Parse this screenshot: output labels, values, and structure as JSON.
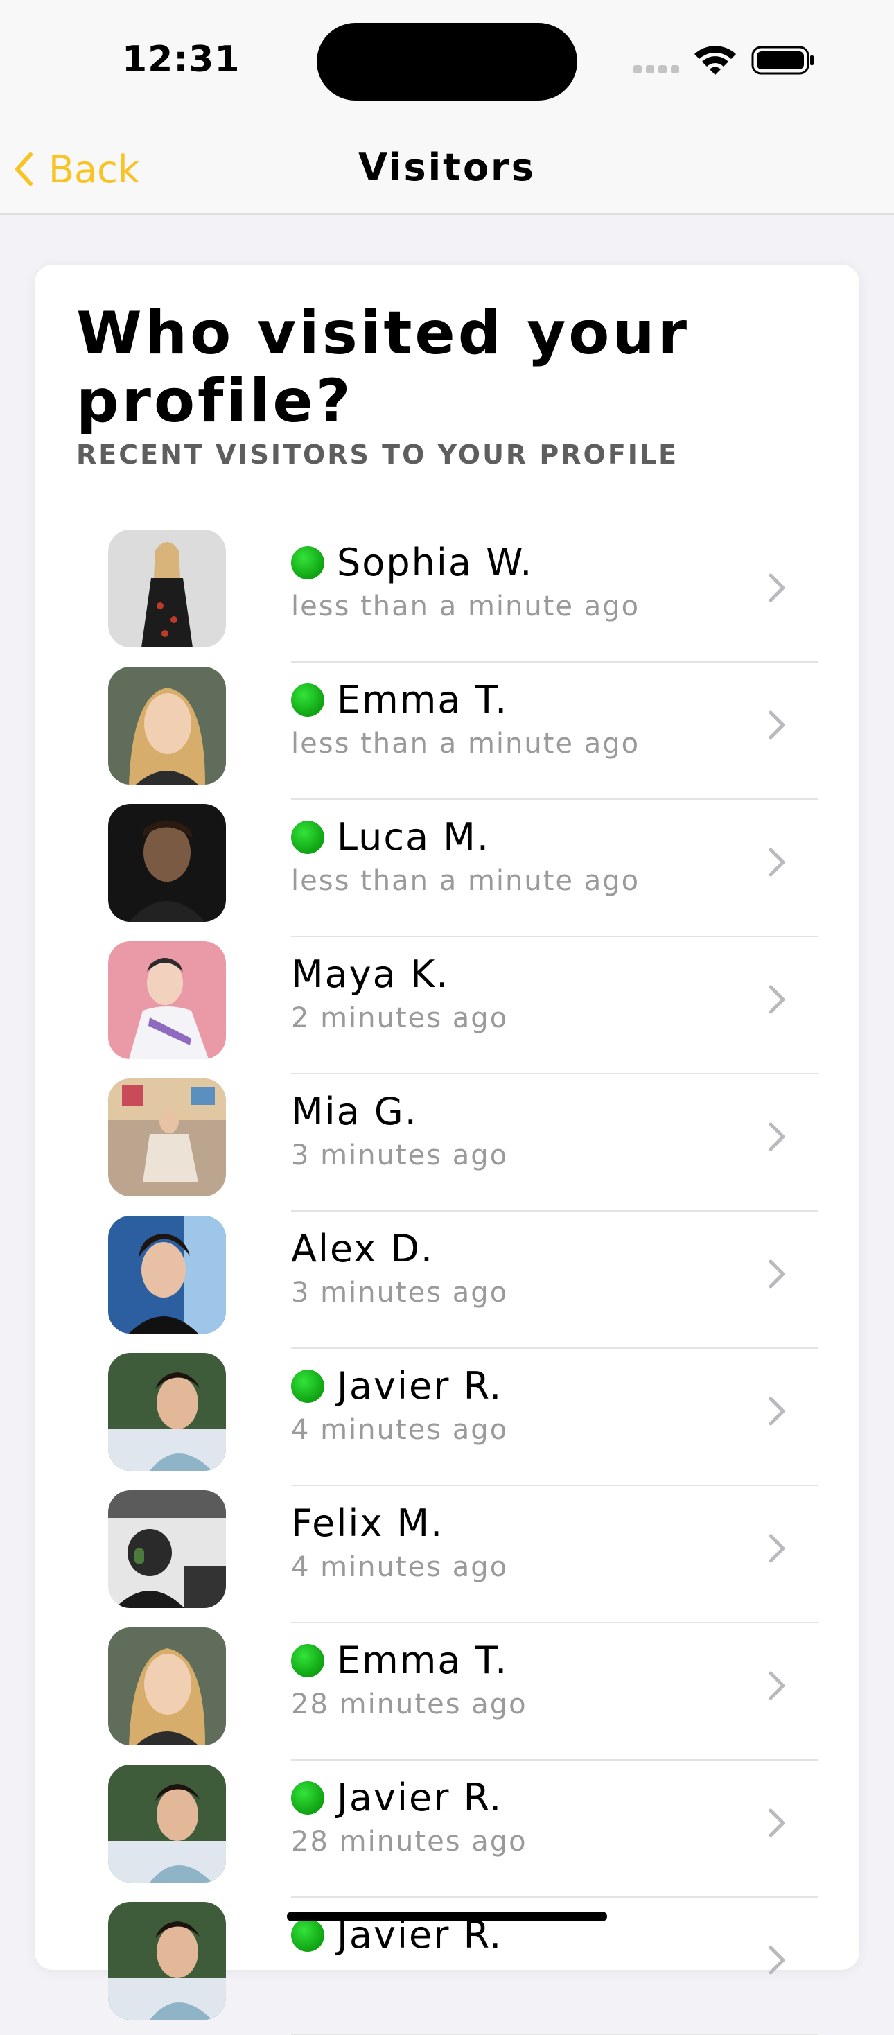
{
  "status_bar": {
    "time": "12:31"
  },
  "nav": {
    "back_label": "Back",
    "title": "Visitors"
  },
  "colors": {
    "accent": "#f7c325",
    "online": "#1ec322",
    "secondary_text": "#9a9a9a"
  },
  "card": {
    "heading": "Who visited your profile?",
    "subheading": "RECENT VISITORS TO YOUR PROFILE"
  },
  "visitors": [
    {
      "name": "Sophia W.",
      "time": "less than a minute ago",
      "online": true,
      "avatar": "photo-woman-dress"
    },
    {
      "name": "Emma T.",
      "time": "less than a minute ago",
      "online": true,
      "avatar": "photo-woman-blonde"
    },
    {
      "name": "Luca M.",
      "time": "less than a minute ago",
      "online": true,
      "avatar": "photo-man-dark"
    },
    {
      "name": "Maya K.",
      "time": "2 minutes ago",
      "online": false,
      "avatar": "photo-woman-pink"
    },
    {
      "name": "Mia G.",
      "time": "3 minutes ago",
      "online": false,
      "avatar": "photo-woman-studio"
    },
    {
      "name": "Alex D.",
      "time": "3 minutes ago",
      "online": false,
      "avatar": "photo-man-curly"
    },
    {
      "name": "Javier R.",
      "time": "4 minutes ago",
      "online": true,
      "avatar": "photo-man-outdoor"
    },
    {
      "name": "Felix M.",
      "time": "4 minutes ago",
      "online": false,
      "avatar": "photo-pilot"
    },
    {
      "name": "Emma T.",
      "time": "28 minutes ago",
      "online": true,
      "avatar": "photo-woman-blonde"
    },
    {
      "name": "Javier R.",
      "time": "28 minutes ago",
      "online": true,
      "avatar": "photo-man-outdoor"
    },
    {
      "name": "Javier R.",
      "time": "",
      "online": true,
      "avatar": "photo-man-outdoor"
    }
  ]
}
